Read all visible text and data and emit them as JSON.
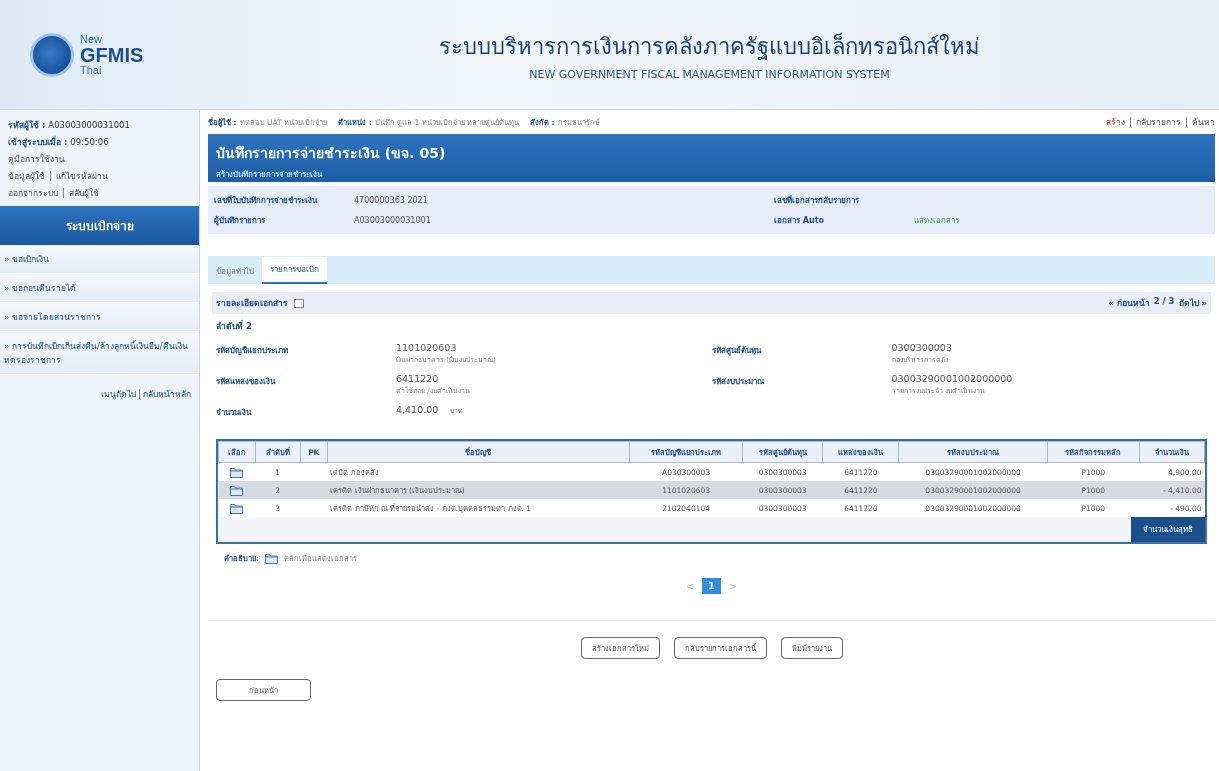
{
  "header": {
    "logo": {
      "top": "New",
      "main": "GFMIS",
      "bottom": "Thai"
    },
    "title": "ระบบบริหารการเงินการคลังภาครัฐแบบอิเล็กทรอนิกส์ใหม่",
    "subtitle": "NEW GOVERNMENT FISCAL MANAGEMENT INFORMATION SYSTEM"
  },
  "sidebar": {
    "user_info": [
      {
        "label": "รหัสผู้ใช้ :",
        "value": "A03003000031001"
      },
      {
        "label": "เข้าสู่ระบบเมื่อ :",
        "value": "09:50:06"
      }
    ],
    "manual_link": "คู่มือการใช้งาน",
    "link_rows": [
      [
        "ข้อมูลผู้ใช้",
        "แก้ไขรหัสผ่าน"
      ],
      [
        "ออกจากระบบ",
        "สลับผู้ใช้"
      ]
    ],
    "section_title": "ระบบเบิกจ่าย",
    "items": [
      {
        "label": "» ขอเบิกเงิน"
      },
      {
        "label": "» ขอถอนคืนรายได้"
      },
      {
        "label": "» ขอจ่ายโดยส่วนราชการ"
      },
      {
        "label": "» การบันทึกเบิกเกินส่งคืน/ล้างลูกหนี้เงินยืม/คืนเงินทดรองราชการ"
      }
    ],
    "footer_links": [
      "เมนูถัดไป",
      "กลับหน้าหลัก"
    ]
  },
  "user_bar": {
    "fields": [
      {
        "label": "ชื่อผู้ใช้ :",
        "value": "ทดสอบ UAT หน่วยเบิกจ่าย"
      },
      {
        "label": "ตำแหน่ง :",
        "value": "บันทึก ดูแล 1 หน่วยเบิกจ่าย หลายศูนย์ต้นทุน"
      },
      {
        "label": "สังกัด :",
        "value": "กรมธนารักษ์"
      }
    ],
    "actions": [
      {
        "label": "สร้าง",
        "kind": "highlight"
      },
      {
        "label": "กลับรายการ",
        "kind": "normal"
      },
      {
        "label": "ค้นหา",
        "kind": "normal"
      }
    ]
  },
  "page_title": {
    "title": "บันทึกรายการจ่ายชำระเงิน (ขจ. 05)",
    "subtitle": "สร้างบันทึกรายการจ่ายชำระเงิน"
  },
  "form": {
    "rows": [
      [
        {
          "label": "เลขที่ใบบันทึกการจ่ายชำระเงิน",
          "value": "4700000363   2021"
        },
        {
          "label": "เลขที่เอกสารกลับรายการ"
        }
      ],
      [
        {
          "label": "ผู้บันทึกรายการ",
          "value": "A03003000031001"
        },
        {
          "label": "เอกสาร Auto",
          "value": "แสดงเอกสาร",
          "kind": "link"
        }
      ]
    ]
  },
  "tabs": [
    {
      "label": "ข้อมูลทั่วไป",
      "selected": false
    },
    {
      "label": "รายการขอเบิก",
      "selected": true
    }
  ],
  "detail": {
    "title": "รายละเอียดเอกสาร",
    "pager": {
      "prev": "« ก่อนหน้า",
      "page": "2 / 3",
      "next": "ถัดไป »"
    },
    "sequence": "ลำดับที่ 2",
    "fields": [
      {
        "label": "รหัสบัญชีแยกประเภท",
        "value": "1101020603",
        "note": "เงินฝากธนาคาร (เงินงบประมาณ)"
      },
      {
        "label": "รหัสศูนย์ต้นทุน",
        "value": "0300300003",
        "note": "กองบริหารการคลัง"
      },
      {
        "label": "รหัสแหล่งของเงิน",
        "value": "6411220",
        "note": "ค่าใช้สอย /งบดำเนินงาน"
      },
      {
        "label": "รหัสงบประมาณ",
        "value": "03003290001002000000",
        "note": "รายการงบประจำ งบดำเนินงาน"
      },
      {
        "label": "จำนวนเงิน",
        "value": "4,410.00",
        "unit": "บาท"
      }
    ]
  },
  "table": {
    "columns": [
      "เลือก",
      "ลำดับที่",
      "PK",
      "ชื่อบัญชี",
      "รหัสบัญชีแยกประเภท",
      "รหัสศูนย์ต้นทุน",
      "แหล่งของเงิน",
      "รหัสงบประมาณ",
      "รหัสกิจกรรมหลัก",
      "จำนวนเงิน"
    ],
    "rows": [
      {
        "selected": false,
        "cells": [
          "",
          "1",
          "",
          "เดบิต  กองคลัง",
          "A030300003",
          "0300300003",
          "6411220",
          "03003290001002000000",
          "P1000",
          "4,900.00"
        ]
      },
      {
        "selected": true,
        "cells": [
          "",
          "2",
          "",
          "เครดิต  เงินฝากธนาคาร (เงินงบประมาณ)",
          "1101020603",
          "0300300003",
          "6411220",
          "03003290001002000000",
          "P1000",
          "- 4,410.00"
        ]
      },
      {
        "selected": false,
        "cells": [
          "",
          "3",
          "",
          "เครดิต  ภาษีหัก ณ ที่จ่ายรอนำส่ง - ภงด.บุคคลธรรมดา ภงด. 1",
          "2102040104",
          "0300300003",
          "6411220",
          "03003290001002000000",
          "P1000",
          "- 490.00"
        ]
      }
    ],
    "net_button": "จำนวนเงินสุทธิ"
  },
  "legend": {
    "label": "คำอธิบาย:",
    "text": "คลิกเพื่อแสดงเอกสาร"
  },
  "pagination": {
    "prev": "<",
    "pages": [
      {
        "label": "1",
        "selected": true
      }
    ],
    "next": ">"
  },
  "buttons": [
    "สร้างเอกสารใหม่",
    "กลับรายการเอกสารนี้",
    "พิมพ์รายงาน"
  ],
  "back_button": "ก่อนหน้า"
}
